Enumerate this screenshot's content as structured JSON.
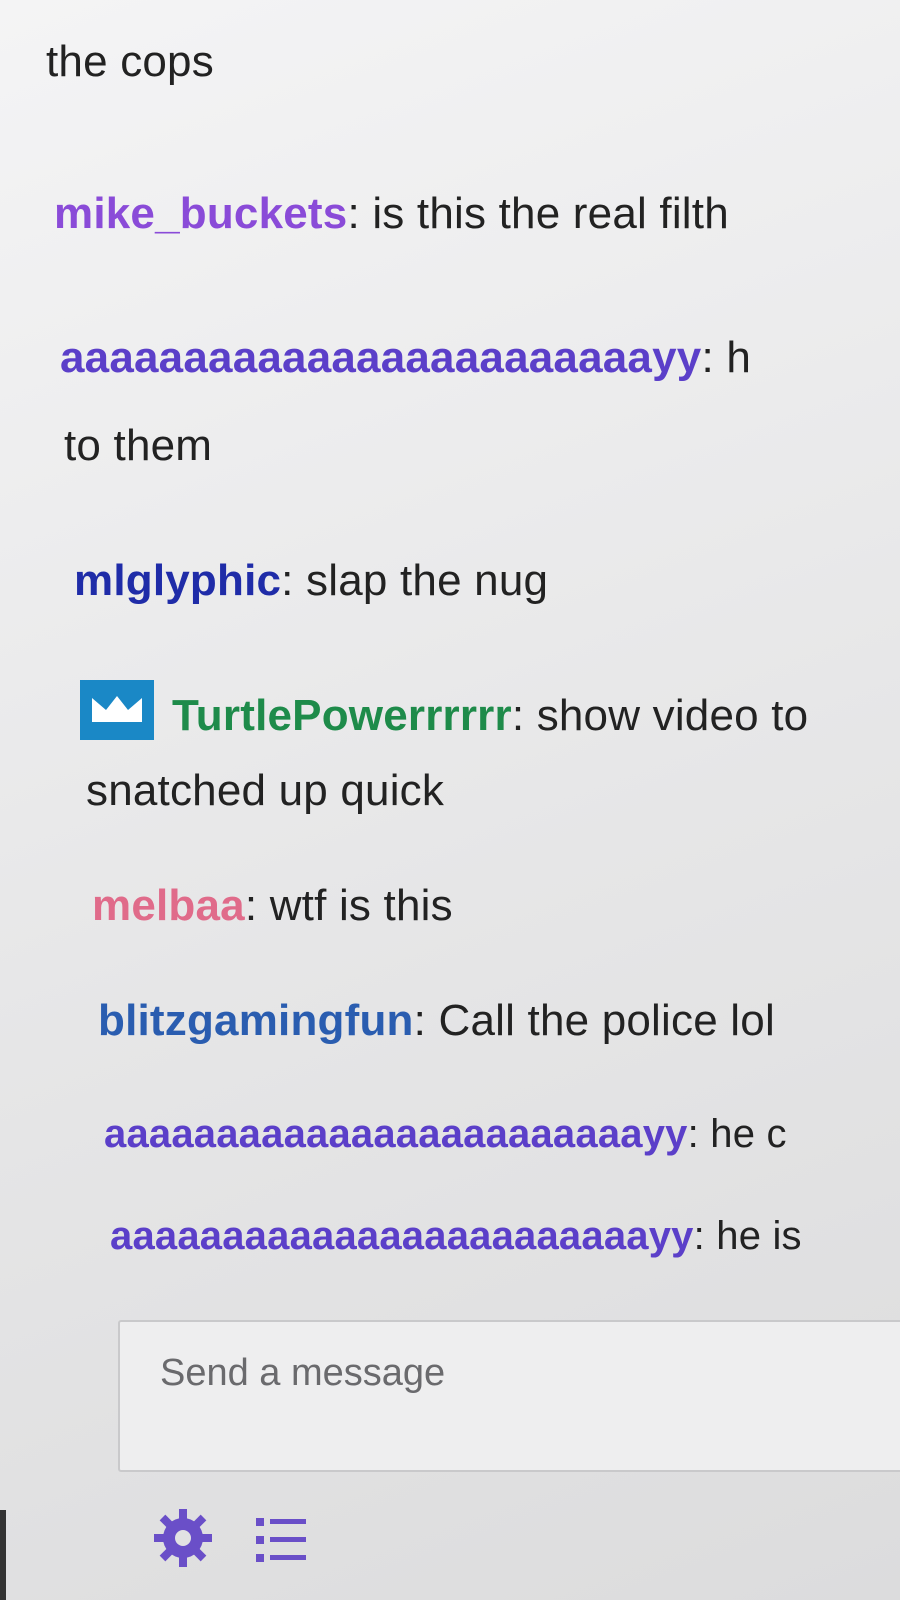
{
  "chat": {
    "messages": [
      {
        "user": "",
        "text": "the cops"
      },
      {
        "user": "mike_buckets",
        "sep": ":",
        "text": " is this the real filth"
      },
      {
        "user": "aaaaaaaaaaaaaaaaaaaaaaaayy",
        "sep": ":",
        "text": " h"
      },
      {
        "user": "",
        "text": "to them"
      },
      {
        "user": "mlglyphic",
        "sep": ":",
        "text": " slap the nug"
      },
      {
        "user": "TurtlePowerrrrrr",
        "sep": ":",
        "text": " show video to"
      },
      {
        "user": "",
        "text": "snatched up quick"
      },
      {
        "user": "melbaa",
        "sep": ":",
        "text": " wtf is this"
      },
      {
        "user": "blitzgamingfun",
        "sep": ":",
        "text": " Call the police lol"
      },
      {
        "user": "aaaaaaaaaaaaaaaaaaaaaaaayy",
        "sep": ":",
        "text": " he c"
      },
      {
        "user": "aaaaaaaaaaaaaaaaaaaaaaaayy",
        "sep": ":",
        "text": " he is"
      }
    ]
  },
  "composer": {
    "placeholder": "Send a message"
  },
  "toolbar": {
    "settings_icon": "gear-icon",
    "list_icon": "list-icon"
  },
  "colors": {
    "purple": "#8a4bd8",
    "indigo": "#5b3fc9",
    "blue": "#1f2ca8",
    "green": "#1e8b4a",
    "pink": "#e06b8a",
    "steel": "#2a5db0",
    "badge": "#1a88c6"
  }
}
